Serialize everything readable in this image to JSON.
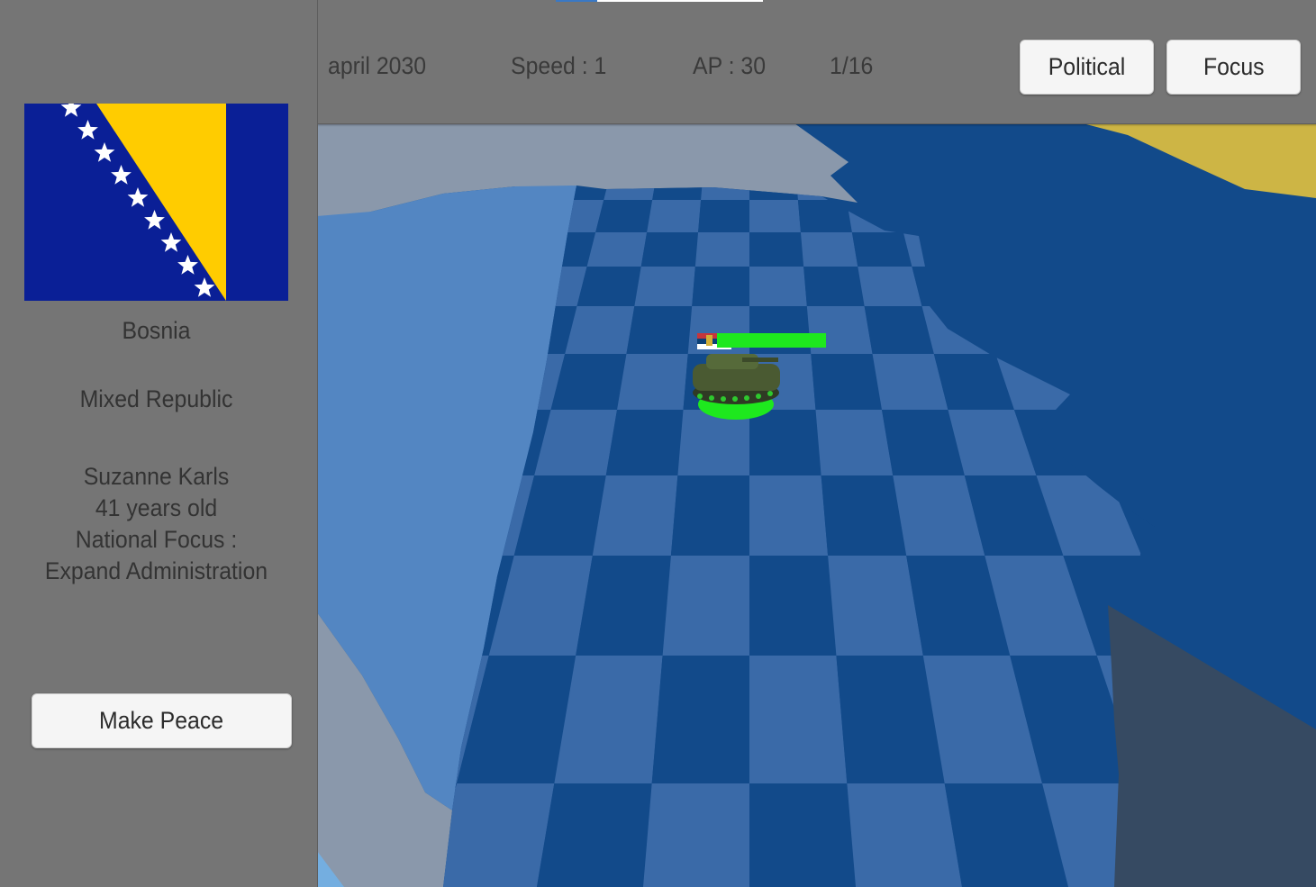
{
  "topbar": {
    "date": "april 2030",
    "speed": "Speed : 1",
    "ap": "AP : 30",
    "turn": "1/16",
    "political_label": "Political",
    "focus_label": "Focus"
  },
  "country": {
    "flag_icon": "bosnia-flag",
    "name": "Bosnia",
    "government": "Mixed Republic",
    "leader_name": "Suzanne Karls",
    "leader_age": "41 years old",
    "focus_label": "National Focus :",
    "focus_value": "Expand Administration",
    "make_peace_label": "Make Peace"
  },
  "map": {
    "unit": {
      "type": "tank",
      "owner_flag_icon": "serbia-flag",
      "health": 1.0
    },
    "colors": {
      "own_territory_dark": "#124a8a",
      "own_territory_light": "#3a6aa8",
      "neighbor_blue": "#5386c2",
      "foreign_grey": "#8a98ab",
      "dark_territory": "#364a62",
      "yellow_territory": "#cdb545",
      "health_bar": "#1ee81e"
    }
  }
}
